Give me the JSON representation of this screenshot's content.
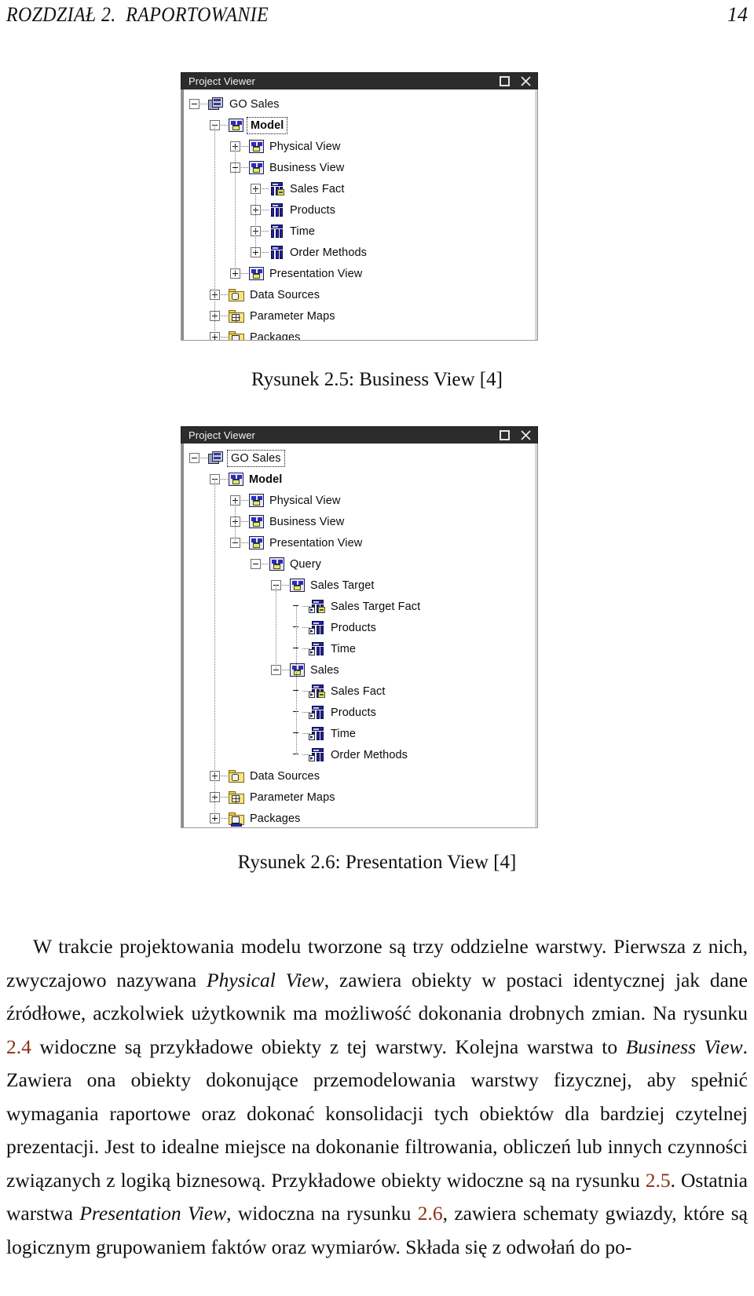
{
  "page": {
    "running_head": "ROZDZIAŁ 2.  RAPORTOWANIE",
    "page_number": "14"
  },
  "figure1": {
    "window_title": "Project Viewer",
    "maximize_icon": "maximize-icon",
    "close_icon": "close-icon",
    "caption": "Rysunek 2.5: Business View [4]",
    "tree": [
      {
        "label": "GO Sales",
        "depth": 0,
        "expander": "minus",
        "icon": "project-icon",
        "bold": false,
        "focus": false
      },
      {
        "label": "Model",
        "depth": 1,
        "expander": "minus",
        "icon": "view-icon",
        "bold": true,
        "focus": true
      },
      {
        "label": "Physical View",
        "depth": 2,
        "expander": "plus",
        "icon": "view-icon",
        "bold": false,
        "focus": false
      },
      {
        "label": "Business View",
        "depth": 2,
        "expander": "minus",
        "icon": "view-icon",
        "bold": false,
        "focus": false
      },
      {
        "label": "Sales Fact",
        "depth": 3,
        "expander": "plus",
        "icon": "table-fact-icon",
        "bold": false,
        "focus": false
      },
      {
        "label": "Products",
        "depth": 3,
        "expander": "plus",
        "icon": "table-icon",
        "bold": false,
        "focus": false
      },
      {
        "label": "Time",
        "depth": 3,
        "expander": "plus",
        "icon": "table-icon",
        "bold": false,
        "focus": false
      },
      {
        "label": "Order Methods",
        "depth": 3,
        "expander": "plus",
        "icon": "table-icon",
        "bold": false,
        "focus": false
      },
      {
        "label": "Presentation View",
        "depth": 2,
        "expander": "plus",
        "icon": "view-icon",
        "bold": false,
        "focus": false
      },
      {
        "label": "Data Sources",
        "depth": 1,
        "expander": "plus",
        "icon": "folder-db-icon",
        "bold": false,
        "focus": false
      },
      {
        "label": "Parameter Maps",
        "depth": 1,
        "expander": "plus",
        "icon": "folder-grid-icon",
        "bold": false,
        "focus": false
      },
      {
        "label": "Packages",
        "depth": 1,
        "expander": "plus",
        "icon": "folder-package-icon",
        "bold": false,
        "focus": false
      }
    ]
  },
  "figure2": {
    "window_title": "Project Viewer",
    "maximize_icon": "maximize-icon",
    "close_icon": "close-icon",
    "caption": "Rysunek 2.6: Presentation View [4]",
    "tree": [
      {
        "label": "GO Sales",
        "depth": 0,
        "expander": "minus",
        "icon": "project-icon",
        "bold": false,
        "focus": true
      },
      {
        "label": "Model",
        "depth": 1,
        "expander": "minus",
        "icon": "view-icon",
        "bold": true,
        "focus": false
      },
      {
        "label": "Physical View",
        "depth": 2,
        "expander": "plus",
        "icon": "view-icon",
        "bold": false,
        "focus": false
      },
      {
        "label": "Business View",
        "depth": 2,
        "expander": "plus",
        "icon": "view-icon",
        "bold": false,
        "focus": false
      },
      {
        "label": "Presentation View",
        "depth": 2,
        "expander": "minus",
        "icon": "view-icon",
        "bold": false,
        "focus": false
      },
      {
        "label": "Query",
        "depth": 3,
        "expander": "minus",
        "icon": "view-icon",
        "bold": false,
        "focus": false
      },
      {
        "label": "Sales Target",
        "depth": 4,
        "expander": "minus",
        "icon": "view-icon",
        "bold": false,
        "focus": false
      },
      {
        "label": "Sales Target Fact",
        "depth": 5,
        "expander": "none",
        "icon": "table-shortcut-fact-icon",
        "bold": false,
        "focus": false
      },
      {
        "label": "Products",
        "depth": 5,
        "expander": "none",
        "icon": "table-shortcut-icon",
        "bold": false,
        "focus": false
      },
      {
        "label": "Time",
        "depth": 5,
        "expander": "none",
        "icon": "table-shortcut-icon",
        "bold": false,
        "focus": false
      },
      {
        "label": "Sales",
        "depth": 4,
        "expander": "minus",
        "icon": "view-icon",
        "bold": false,
        "focus": false
      },
      {
        "label": "Sales Fact",
        "depth": 5,
        "expander": "none",
        "icon": "table-shortcut-fact-icon",
        "bold": false,
        "focus": false
      },
      {
        "label": "Products",
        "depth": 5,
        "expander": "none",
        "icon": "table-shortcut-icon",
        "bold": false,
        "focus": false
      },
      {
        "label": "Time",
        "depth": 5,
        "expander": "none",
        "icon": "table-shortcut-icon",
        "bold": false,
        "focus": false
      },
      {
        "label": "Order Methods",
        "depth": 5,
        "expander": "none",
        "icon": "table-shortcut-icon",
        "bold": false,
        "focus": false
      },
      {
        "label": "Data Sources",
        "depth": 1,
        "expander": "plus",
        "icon": "folder-db-icon",
        "bold": false,
        "focus": false
      },
      {
        "label": "Parameter Maps",
        "depth": 1,
        "expander": "plus",
        "icon": "folder-grid-icon",
        "bold": false,
        "focus": false
      },
      {
        "label": "Packages",
        "depth": 1,
        "expander": "plus",
        "icon": "folder-package-icon",
        "bold": false,
        "focus": false
      }
    ]
  },
  "body": {
    "p1_a": "W trakcie projektowania modelu tworzone są trzy oddzielne warstwy. Pierwsza z nich, zwyczajowo nazywana ",
    "p1_i1": "Physical View",
    "p1_b": ", zawiera obiekty w postaci identycznej jak dane źródłowe, aczkolwiek użytkownik ma możliwość dokonania drobnych zmian. Na rysunku ",
    "p1_ref1": "2.4",
    "p1_c": " widoczne są przykładowe obiekty z tej warstwy. Kolejna warstwa to ",
    "p1_i2": "Business View",
    "p1_d": ". Zawiera ona obiekty dokonujące przemodelowania warstwy fizycznej, aby spełnić wymagania raportowe oraz dokonać konsolidacji tych obiektów dla bardziej czytelnej prezentacji. Jest to idealne miejsce na dokonanie filtrowania, obliczeń lub innych czynności związanych z logiką biznesową. Przykładowe obiekty widoczne są na rysunku ",
    "p1_ref2": "2.5",
    "p1_e": ". Ostatnia warstwa ",
    "p1_i3": "Presentation View",
    "p1_f": ", widoczna na rysunku ",
    "p1_ref3": "2.6",
    "p1_g": ", zawiera schematy gwiazdy, które są logicznym grupowaniem faktów oraz wymiarów. Składa się z odwołań do po-"
  },
  "colors": {
    "titlebar_bg": "#2c2c2c",
    "titlebar_text": "#f2f2f2",
    "reference_link": "#8c2f13",
    "folder_yellow": "#f7e383",
    "table_blue": "#2222b4"
  }
}
